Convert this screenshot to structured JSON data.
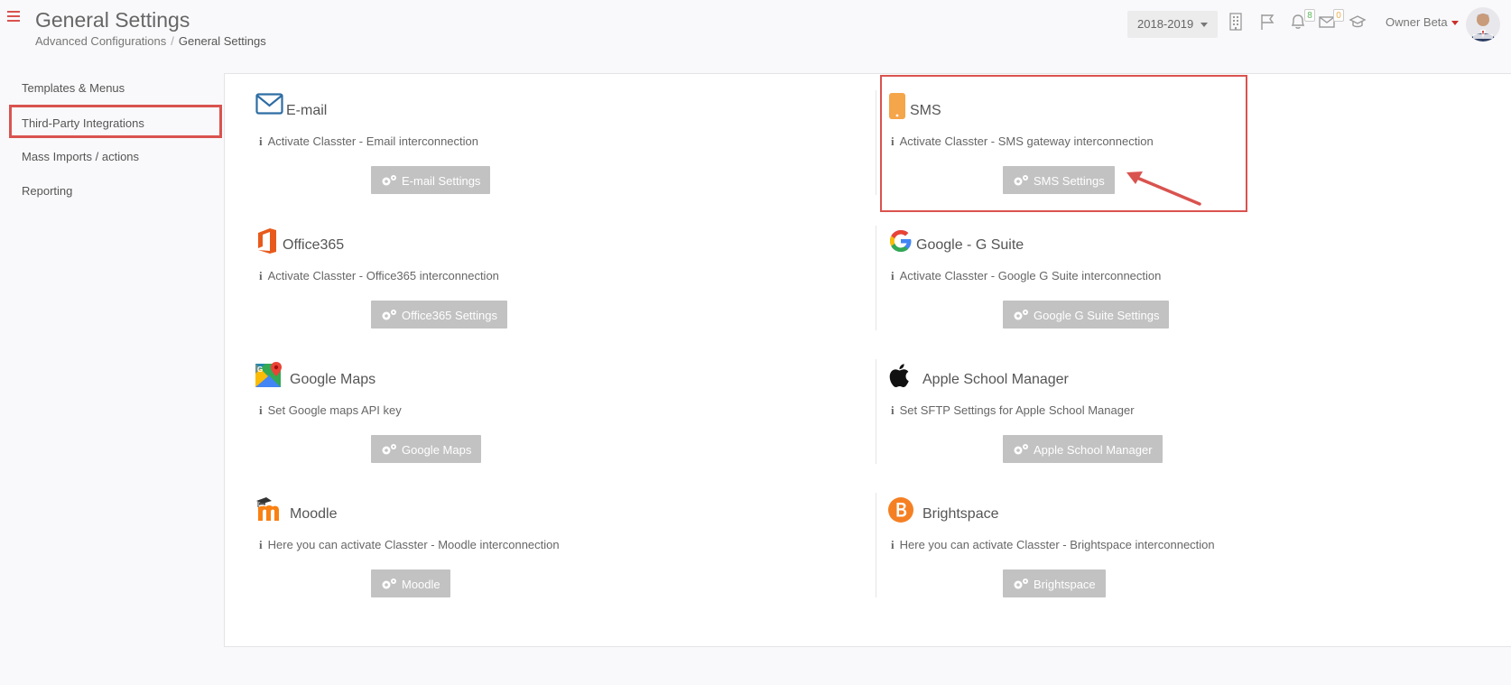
{
  "header": {
    "title": "General Settings",
    "breadcrumb": [
      "Advanced Configurations",
      "General Settings"
    ],
    "year": "2018-2019",
    "notifications_count": "8",
    "messages_count": "0",
    "user_name": "Owner Beta"
  },
  "sidebar": {
    "items": [
      {
        "label": "Templates & Menus"
      },
      {
        "label": "Third-Party Integrations",
        "active": true
      },
      {
        "label": "Mass Imports / actions"
      },
      {
        "label": "Reporting"
      }
    ]
  },
  "integrations": [
    {
      "title": "E-mail",
      "description": "Activate Classter - Email interconnection",
      "button": "E-mail Settings",
      "icon": "envelope-icon"
    },
    {
      "title": "SMS",
      "description": "Activate Classter - SMS gateway interconnection",
      "button": "SMS Settings",
      "icon": "mobile-phone-icon"
    },
    {
      "title": "Office365",
      "description": "Activate Classter - Office365 interconnection",
      "button": "Office365 Settings",
      "icon": "office365-icon"
    },
    {
      "title": "Google - G Suite",
      "description": "Activate Classter - Google G Suite interconnection",
      "button": "Google G Suite Settings",
      "icon": "google-icon"
    },
    {
      "title": "Google Maps",
      "description": "Set Google maps API key",
      "button": "Google Maps",
      "icon": "google-maps-icon"
    },
    {
      "title": "Apple School Manager",
      "description": "Set SFTP Settings for Apple School Manager",
      "button": "Apple School Manager",
      "icon": "apple-icon"
    },
    {
      "title": "Moodle",
      "description": "Here you can activate Classter - Moodle interconnection",
      "button": "Moodle",
      "icon": "moodle-icon"
    },
    {
      "title": "Brightspace",
      "description": "Here you can activate Classter - Brightspace interconnection",
      "button": "Brightspace",
      "icon": "brightspace-icon"
    }
  ],
  "colors": {
    "accent_red": "#d9534f",
    "button_gray": "#c2c2c2",
    "email_blue": "#2e6da4",
    "sms_orange": "#f5a54a",
    "office_orange": "#e85a1b",
    "moodle_orange": "#f98012",
    "brightspace_orange": "#f58024"
  }
}
